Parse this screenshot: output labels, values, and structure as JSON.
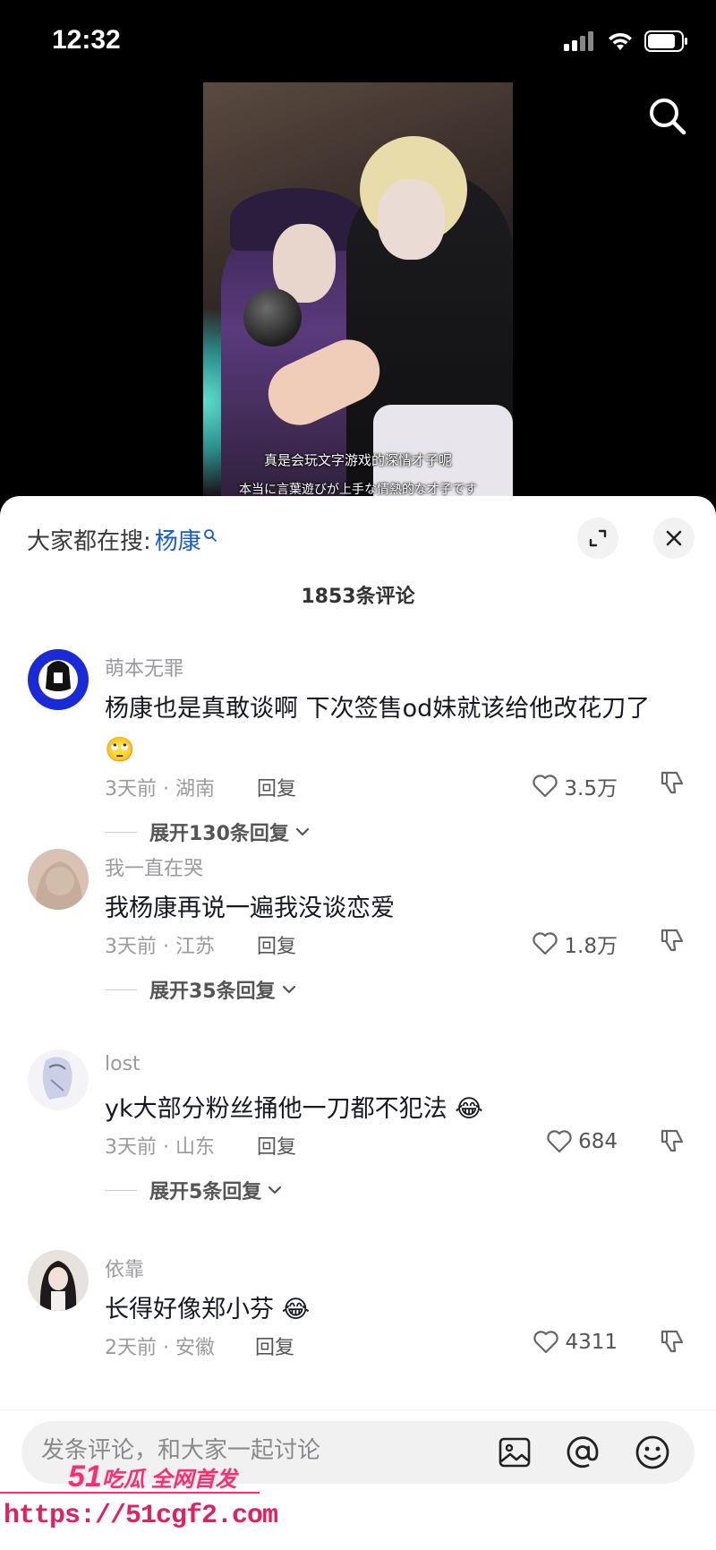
{
  "status_bar": {
    "time": "12:32"
  },
  "video": {
    "caption_line1": "真是会玩文字游戏的深情才子呢",
    "caption_line2": "本当に言葉遊びが上手な情熱的な才子です"
  },
  "comments_panel": {
    "search_prefix": "大家都在搜:",
    "search_term": "杨康",
    "comment_count": "1853条评论"
  },
  "comments": [
    {
      "user": "萌本无罪",
      "text": "杨康也是真敢谈啊 下次签售od妹就该给他改花刀了",
      "emoji": "🙄",
      "meta": "3天前 · 湖南",
      "reply": "回复",
      "likes": "3.5万",
      "expand": "展开130条回复"
    },
    {
      "user": "我一直在哭",
      "text": "我杨康再说一遍我没谈恋爱",
      "meta": "3天前 · 江苏",
      "reply": "回复",
      "likes": "1.8万",
      "expand": "展开35条回复"
    },
    {
      "user": "lost",
      "text": "yk大部分粉丝捅他一刀都不犯法",
      "emoji": "😂",
      "meta": "3天前 · 山东",
      "reply": "回复",
      "likes": "684",
      "expand": "展开5条回复"
    },
    {
      "user": "依靠",
      "text": "长得好像郑小芬",
      "emoji": "😂",
      "meta": "2天前 · 安徽",
      "reply": "回复",
      "likes": "4311"
    }
  ],
  "input_bar": {
    "placeholder": "发条评论，和大家一起讨论"
  },
  "watermark": {
    "line1_num": "51",
    "line1_text": "吃瓜 全网首发",
    "url": "https://51cgf2.com"
  },
  "icons": [
    "signal-icon",
    "wifi-icon",
    "battery-icon",
    "search-icon",
    "expand-icon",
    "close-icon",
    "heart-icon",
    "dislike-icon",
    "chevron-down-icon",
    "image-icon",
    "at-icon",
    "emoji-icon"
  ]
}
